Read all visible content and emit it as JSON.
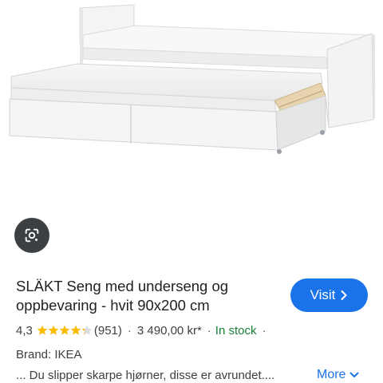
{
  "product": {
    "title": "SLÄKT Seng med underseng og oppbevaring - hvit 90x200 cm",
    "rating": "4,3",
    "rating_value": 4.3,
    "rating_max": 5,
    "reviews": "(951)",
    "price": "3 490,00 kr*",
    "availability": "In stock",
    "brand": "Brand: IKEA",
    "snippet": "... Du slipper skarpe hjørner, disse er avrundet...."
  },
  "actions": {
    "visit_label": "Visit",
    "more_label": "More"
  },
  "separators": {
    "dot": "·"
  },
  "icons": {
    "lens": "google-lens-icon",
    "visit": "chevron-right-icon",
    "more": "chevron-down-icon",
    "star": "star-icon"
  },
  "colors": {
    "accent": "#1a73e8",
    "in_stock": "#188038",
    "star": "#fbbc04",
    "lens_bg": "#3c4043"
  }
}
